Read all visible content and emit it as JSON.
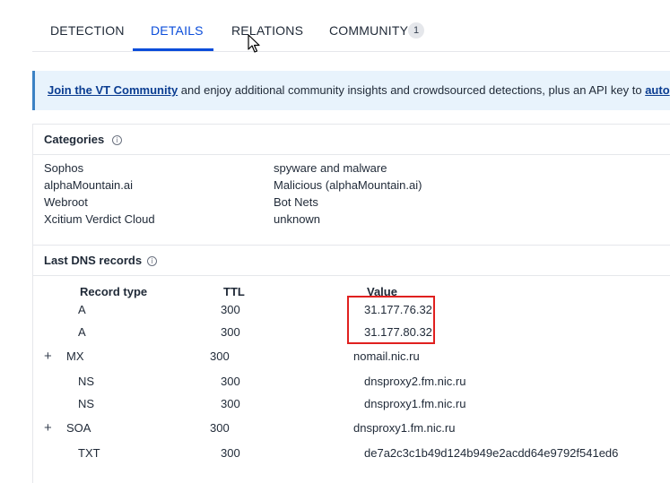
{
  "tabs": [
    {
      "label": "DETECTION"
    },
    {
      "label": "DETAILS"
    },
    {
      "label": "RELATIONS"
    },
    {
      "label": "COMMUNITY",
      "badge": "1"
    }
  ],
  "banner": {
    "link_text": "Join the VT Community",
    "text": " and enjoy additional community insights and crowdsourced detections, plus an API key to ",
    "trailing_link": "auto"
  },
  "categories": {
    "title": "Categories",
    "rows": [
      {
        "vendor": "Sophos",
        "category": "spyware and malware"
      },
      {
        "vendor": "alphaMountain.ai",
        "category": "Malicious (alphaMountain.ai)"
      },
      {
        "vendor": "Webroot",
        "category": "Bot Nets"
      },
      {
        "vendor": "Xcitium Verdict Cloud",
        "category": "unknown"
      }
    ]
  },
  "dns": {
    "title": "Last DNS records",
    "headers": {
      "type": "Record type",
      "ttl": "TTL",
      "value": "Value"
    },
    "rows": [
      {
        "type": "A",
        "ttl": "300",
        "value": "31.177.76.32"
      },
      {
        "type": "A",
        "ttl": "300",
        "value": "31.177.80.32"
      },
      {
        "type": "MX",
        "ttl": "300",
        "value": "nomail.nic.ru",
        "expand": "+"
      },
      {
        "type": "NS",
        "ttl": "300",
        "value": "dnsproxy2.fm.nic.ru"
      },
      {
        "type": "NS",
        "ttl": "300",
        "value": "dnsproxy1.fm.nic.ru"
      },
      {
        "type": "SOA",
        "ttl": "300",
        "value": "dnsproxy1.fm.nic.ru",
        "expand": "+"
      },
      {
        "type": "TXT",
        "ttl": "300",
        "value": "de7a2c3c1b49d124b949e2acdd64e9792f541ed6"
      }
    ]
  },
  "colors": {
    "accent": "#0b4dda",
    "banner_bg": "#e8f3fc",
    "highlight": "#e0201f"
  },
  "icons": {
    "info": "info-circle-icon",
    "cursor": "mouse-pointer-icon",
    "expand": "plus-icon"
  }
}
